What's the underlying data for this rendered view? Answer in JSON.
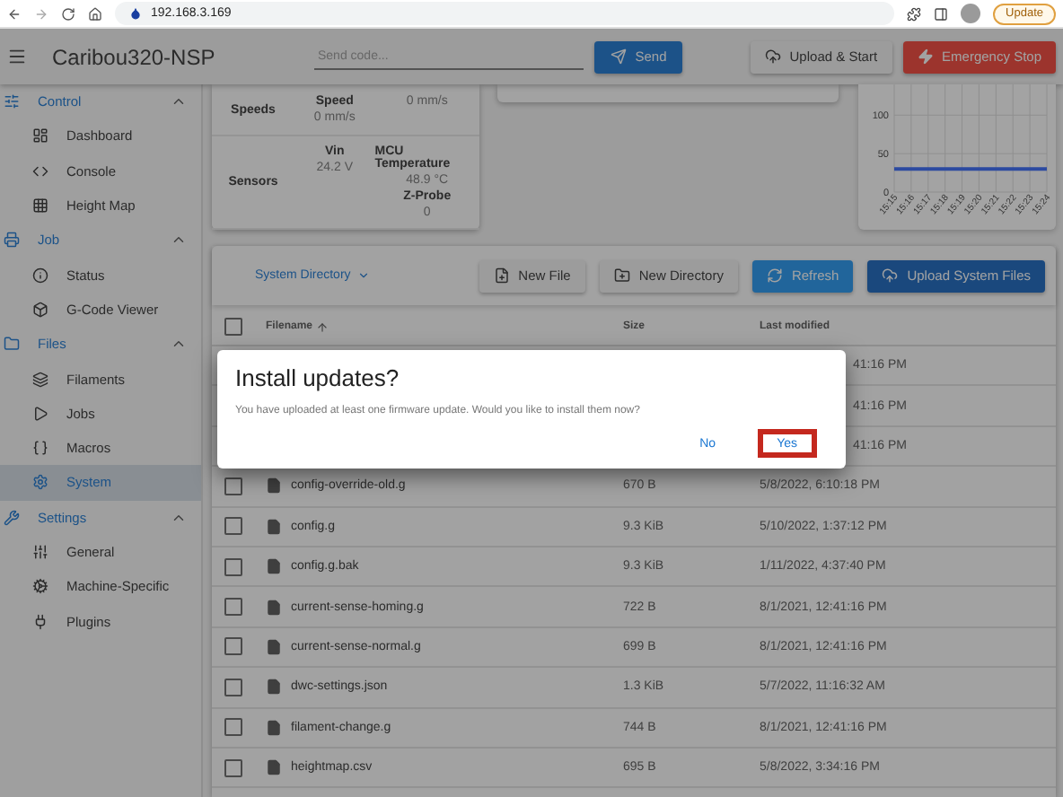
{
  "browser": {
    "address": "192.168.3.169",
    "update_button": "Update"
  },
  "app_bar": {
    "title": "Caribou320-NSP",
    "code_placeholder": "Send code...",
    "send_button": "Send",
    "upload_button": "Upload & Start",
    "stop_button": "Emergency Stop"
  },
  "sidebar": {
    "sections": [
      {
        "label": "Control",
        "kind": "control",
        "expanded": true,
        "items": [
          {
            "label": "Dashboard",
            "kind": "dashboard",
            "selected": false
          },
          {
            "label": "Console",
            "kind": "console",
            "selected": false
          },
          {
            "label": "Height Map",
            "kind": "heightmap",
            "selected": false
          }
        ]
      },
      {
        "label": "Job",
        "kind": "job",
        "expanded": true,
        "items": [
          {
            "label": "Status",
            "kind": "status",
            "selected": false
          },
          {
            "label": "G-Code Viewer",
            "kind": "viewer",
            "selected": false
          }
        ]
      },
      {
        "label": "Files",
        "kind": "files",
        "expanded": true,
        "items": [
          {
            "label": "Filaments",
            "kind": "filaments",
            "selected": false
          },
          {
            "label": "Jobs",
            "kind": "jobs",
            "selected": false
          },
          {
            "label": "Macros",
            "kind": "macros",
            "selected": false
          },
          {
            "label": "System",
            "kind": "system",
            "selected": true
          }
        ]
      },
      {
        "label": "Settings",
        "kind": "settings",
        "expanded": true,
        "items": [
          {
            "label": "General",
            "kind": "general",
            "selected": false
          },
          {
            "label": "Machine-Specific",
            "kind": "machine",
            "selected": false
          },
          {
            "label": "Plugins",
            "kind": "plugins",
            "selected": false
          }
        ]
      }
    ]
  },
  "status_card": {
    "speeds": {
      "label": "Speeds",
      "readings": [
        {
          "heading": "Speed",
          "value": "0 mm/s"
        },
        {
          "value": "0 mm/s"
        }
      ]
    },
    "sensors": {
      "label": "Sensors",
      "readings": [
        {
          "heading": "Vin",
          "value": "24.2 V"
        },
        {
          "heading": "MCU Temperature",
          "value": "48.9 °C"
        },
        {
          "heading": "Z-Probe",
          "value": "0"
        }
      ]
    }
  },
  "chart": {
    "chart_data": {
      "type": "line",
      "grid": true,
      "categories": [
        "15:15",
        "15:16",
        "15:17",
        "15:18",
        "15:19",
        "15:20",
        "15:21",
        "15:22",
        "15:23",
        "15:24"
      ],
      "ylim": [
        0,
        140
      ],
      "yticks": [
        0,
        50,
        100
      ],
      "series": [
        {
          "color": "#2c4aa0",
          "values": [
            30,
            30,
            30,
            30,
            30,
            30,
            30,
            30,
            30,
            30
          ]
        }
      ]
    }
  },
  "files": {
    "directory": "System Directory",
    "buttons": [
      {
        "label": "New File",
        "kind": "new-file"
      },
      {
        "label": "New Directory",
        "kind": "new-directory"
      },
      {
        "label": "Refresh",
        "kind": "refresh"
      },
      {
        "label": "Upload System Files",
        "kind": "upload"
      }
    ],
    "all_checked": false,
    "columns": [
      {
        "label": "Filename",
        "sorted": true
      },
      {
        "label": "Size",
        "sorted": false
      },
      {
        "label": "Last modified",
        "sorted": false
      }
    ],
    "rows": [
      {
        "last_modified": "41:16 PM"
      },
      {
        "last_modified": "41:16 PM"
      },
      {
        "last_modified": "41:16 PM"
      },
      {
        "name": "config-override-old.g",
        "size": "670 B",
        "last_modified": "5/8/2022, 6:10:18 PM",
        "checked": false
      },
      {
        "name": "config.g",
        "size": "9.3 KiB",
        "last_modified": "5/10/2022, 1:37:12 PM",
        "checked": false
      },
      {
        "name": "config.g.bak",
        "size": "9.3 KiB",
        "last_modified": "1/11/2022, 4:37:40 PM",
        "checked": false
      },
      {
        "name": "current-sense-homing.g",
        "size": "722 B",
        "last_modified": "8/1/2021, 12:41:16 PM",
        "checked": false
      },
      {
        "name": "current-sense-normal.g",
        "size": "699 B",
        "last_modified": "8/1/2021, 12:41:16 PM",
        "checked": false
      },
      {
        "name": "dwc-settings.json",
        "size": "1.3 KiB",
        "last_modified": "5/7/2022, 11:16:32 AM",
        "checked": false
      },
      {
        "name": "filament-change.g",
        "size": "744 B",
        "last_modified": "8/1/2021, 12:41:16 PM",
        "checked": false
      },
      {
        "name": "heightmap.csv",
        "size": "695 B",
        "last_modified": "5/8/2022, 3:34:16 PM",
        "checked": false
      }
    ]
  },
  "dialog": {
    "title": "Install updates?",
    "message": "You have uploaded at least one firmware update. Would you like to install them now?",
    "buttons": [
      {
        "label": "No",
        "highlighted": false
      },
      {
        "label": "Yes",
        "highlighted": true
      }
    ]
  }
}
